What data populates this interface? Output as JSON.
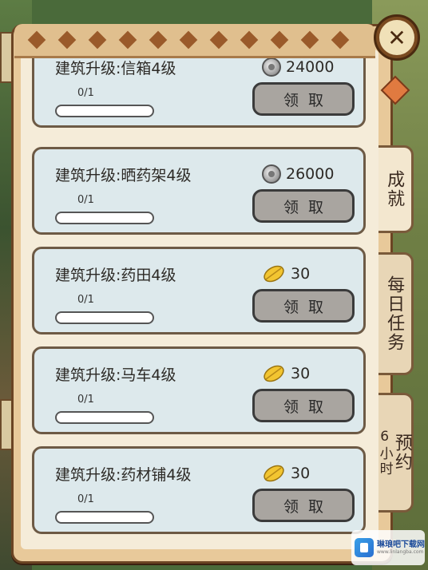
{
  "tasks": [
    {
      "title": "建筑升级:信箱4级",
      "reward_type": "silver-coin-icon",
      "reward_amount": "24000",
      "progress": "0/1",
      "progress_ratio": 0,
      "claim_label": "领取"
    },
    {
      "title": "建筑升级:晒药架4级",
      "reward_type": "silver-coin-icon",
      "reward_amount": "26000",
      "progress": "0/1",
      "progress_ratio": 0,
      "claim_label": "领取"
    },
    {
      "title": "建筑升级:药田4级",
      "reward_type": "gold-leaf-icon",
      "reward_amount": "30",
      "progress": "0/1",
      "progress_ratio": 0,
      "claim_label": "领取"
    },
    {
      "title": "建筑升级:马车4级",
      "reward_type": "gold-leaf-icon",
      "reward_amount": "30",
      "progress": "0/1",
      "progress_ratio": 0,
      "claim_label": "领取"
    },
    {
      "title": "建筑升级:药材铺4级",
      "reward_type": "gold-leaf-icon",
      "reward_amount": "30",
      "progress": "0/1",
      "progress_ratio": 0,
      "claim_label": "领取"
    }
  ],
  "tabs": {
    "achievements": "成就",
    "daily_tasks": "每日任务",
    "booking": "预约",
    "booking_duration": "6小时"
  },
  "close_icon": "close-icon",
  "watermark": {
    "text": "琳琅吧下载网",
    "sub": "www.linlangba.com"
  },
  "colors": {
    "claim_button": "#a9a5a0",
    "card_bg": "#dde9ec",
    "panel_bg": "#e8c99a"
  }
}
